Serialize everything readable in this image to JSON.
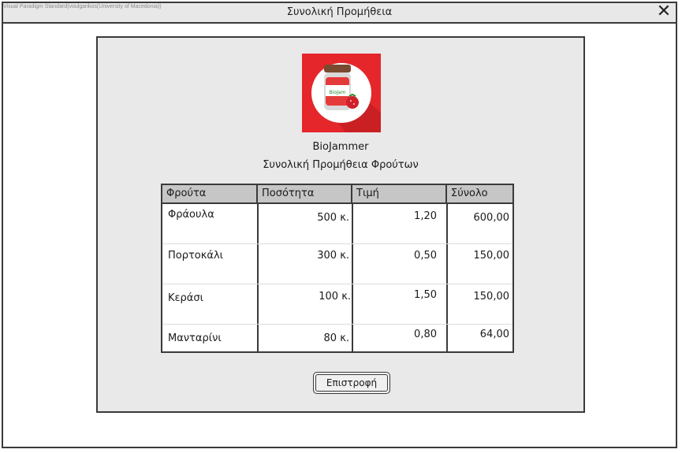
{
  "window": {
    "watermark": "Visual Paradigm Standard(voulgarikos(University of Macedonia))",
    "title": "Συνολική Προμήθεια",
    "close_glyph": "✕"
  },
  "logo": {
    "icon": "jam-jar-icon",
    "jar_label": "BioJam"
  },
  "brand": "BioJammer",
  "subtitle": "Συνολική Προμήθεια Φρούτων",
  "table": {
    "headers": [
      "Φρούτα",
      "Ποσότητα",
      "Τιμή",
      "Σύνολο"
    ],
    "rows": [
      {
        "fruit": "Φράουλα",
        "qty": "500 κ.",
        "price": "1,20",
        "total": "600,00"
      },
      {
        "fruit": "Πορτοκάλι",
        "qty": "300 κ.",
        "price": "0,50",
        "total": "150,00"
      },
      {
        "fruit": "Κεράσι",
        "qty": "100 κ.",
        "price": "1,50",
        "total": "150,00"
      },
      {
        "fruit": "Μανταρίνι",
        "qty": "80 κ.",
        "price": "0,80",
        "total": "64,00"
      }
    ]
  },
  "button": {
    "label": "Επιστροφή"
  },
  "colors": {
    "logo_bg": "#e5262a",
    "panel_bg": "#e9e9e9",
    "header_bg": "#c6c6c6"
  }
}
